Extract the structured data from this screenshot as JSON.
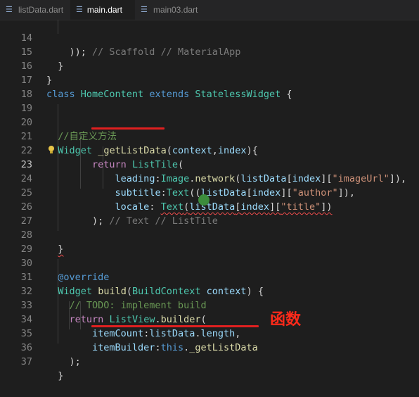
{
  "tabs": [
    {
      "label": "listData.dart",
      "active": false,
      "modified": false
    },
    {
      "label": "main.dart",
      "active": true,
      "modified": true
    },
    {
      "label": "main03.dart",
      "active": false,
      "modified": false
    }
  ],
  "lines": [
    {
      "n": "14",
      "text": "    )); // Scaffold // MaterialApp"
    },
    {
      "n": "15",
      "text": "  }"
    },
    {
      "n": "16",
      "text": "}"
    },
    {
      "n": "17",
      "text": "class HomeContent extends StatelessWidget {"
    },
    {
      "n": "18",
      "text": ""
    },
    {
      "n": "19",
      "text": ""
    },
    {
      "n": "20",
      "text": "  //自定义方法"
    },
    {
      "n": "21",
      "text": "  Widget _getListData(context,index){"
    },
    {
      "n": "22",
      "text": "        return ListTile("
    },
    {
      "n": "23",
      "text": "            leading:Image.network(listData[index][\"imageUrl\"]),"
    },
    {
      "n": "24",
      "text": "            subtitle:Text((listData[index][\"author\"]),"
    },
    {
      "n": "25",
      "text": "            locale: Text(listData[index][\"title\"])"
    },
    {
      "n": "26",
      "text": "        ); // Text // ListTile"
    },
    {
      "n": "27",
      "text": ""
    },
    {
      "n": "28",
      "text": "  }"
    },
    {
      "n": "29",
      "text": ""
    },
    {
      "n": "30",
      "text": "  @override"
    },
    {
      "n": "31",
      "text": "  Widget build(BuildContext context) {"
    },
    {
      "n": "32",
      "text": "    // TODO: implement build"
    },
    {
      "n": "33",
      "text": "    return ListView.builder("
    },
    {
      "n": "34",
      "text": "        itemCount:listData.length,"
    },
    {
      "n": "35",
      "text": "        itemBuilder:this._getListData"
    },
    {
      "n": "36",
      "text": "    );"
    },
    {
      "n": "37",
      "text": "  }"
    }
  ],
  "current_line": "23",
  "annotation": "函数",
  "colors": {
    "annotation": "#ff2a1a",
    "underline": "#e02020",
    "background": "#1e1e1e"
  }
}
